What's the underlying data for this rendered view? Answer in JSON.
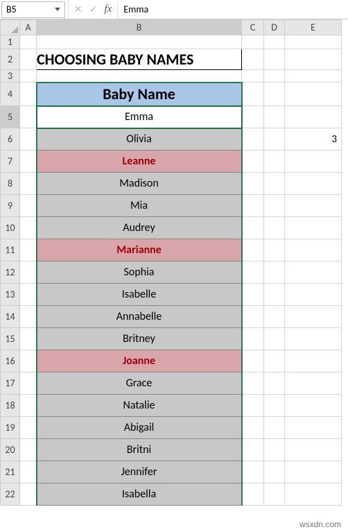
{
  "formula_bar": {
    "namebox": "B5",
    "cancel": "✕",
    "confirm": "✓",
    "fx": "fx",
    "value": "Emma"
  },
  "cols": {
    "A": "A",
    "B": "B",
    "C": "C",
    "D": "D",
    "E": "E"
  },
  "rows": [
    "1",
    "2",
    "3",
    "4",
    "5",
    "6",
    "7",
    "8",
    "9",
    "10",
    "11",
    "12",
    "13",
    "14",
    "15",
    "16",
    "17",
    "18",
    "19",
    "20",
    "21",
    "22"
  ],
  "title": "CHOOSING BABY NAMES",
  "header": "Baby Name",
  "e6": "3",
  "names": [
    {
      "v": "Emma",
      "cls": "sel"
    },
    {
      "v": "Olivia",
      "cls": ""
    },
    {
      "v": "Leanne",
      "cls": "red"
    },
    {
      "v": "Madison",
      "cls": ""
    },
    {
      "v": "Mia",
      "cls": ""
    },
    {
      "v": "Audrey",
      "cls": ""
    },
    {
      "v": "Marianne",
      "cls": "red"
    },
    {
      "v": "Sophia",
      "cls": ""
    },
    {
      "v": "Isabelle",
      "cls": ""
    },
    {
      "v": "Annabelle",
      "cls": ""
    },
    {
      "v": "Britney",
      "cls": ""
    },
    {
      "v": "Joanne",
      "cls": "red"
    },
    {
      "v": "Grace",
      "cls": ""
    },
    {
      "v": "Natalie",
      "cls": ""
    },
    {
      "v": "Abigail",
      "cls": ""
    },
    {
      "v": "Britni",
      "cls": ""
    },
    {
      "v": "Jennifer",
      "cls": ""
    },
    {
      "v": "Isabella",
      "cls": ""
    }
  ],
  "watermark": "wsxdn.com"
}
